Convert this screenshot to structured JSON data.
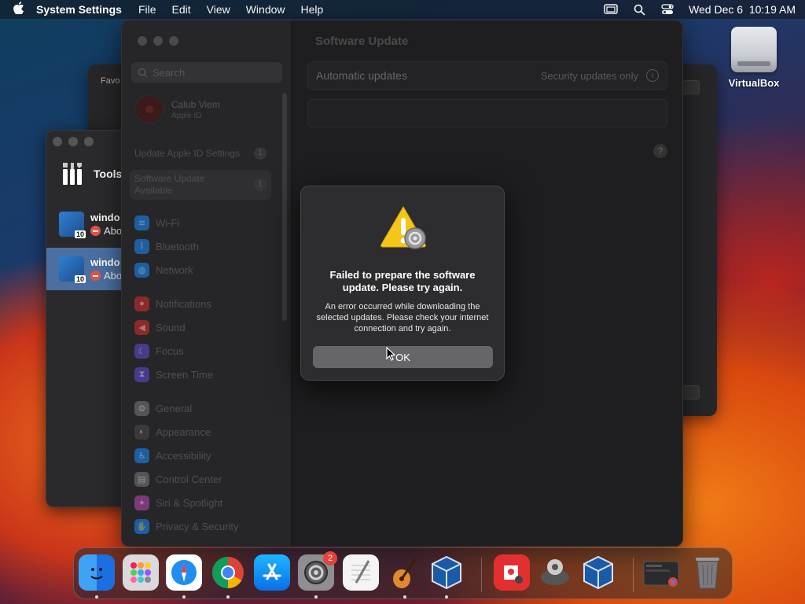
{
  "menubar": {
    "app_name": "System Settings",
    "menus": [
      "File",
      "Edit",
      "View",
      "Window",
      "Help"
    ],
    "datetime": "Wed Dec 6  10:19 AM"
  },
  "desktop": {
    "icons": [
      {
        "label": "VirtualBox",
        "icon": "disk-icon"
      }
    ]
  },
  "background_window": {
    "sidebar_label": "Favo"
  },
  "virtualbox": {
    "tools_label": "Tools",
    "vms": [
      {
        "name": "windo",
        "state": "Abo",
        "selected": false
      },
      {
        "name": "windo",
        "state": "Abo",
        "selected": true
      }
    ]
  },
  "settings": {
    "search_placeholder": "Search",
    "account": {
      "name": "Calub Viem",
      "subtitle": "Apple ID"
    },
    "notices": [
      {
        "label": "Update Apple ID Settings",
        "count": "1"
      },
      {
        "label": "Software Update Available",
        "count": "1"
      }
    ],
    "sidebar_items": [
      {
        "label": "Wi-Fi",
        "icon": "wifi-icon",
        "color": "#1f5f9f"
      },
      {
        "label": "Bluetooth",
        "icon": "bluetooth-icon",
        "color": "#1f5f9f"
      },
      {
        "label": "Network",
        "icon": "network-icon",
        "color": "#1f5f9f"
      },
      {
        "label": "Notifications",
        "icon": "bell-icon",
        "color": "#8a2a2a"
      },
      {
        "label": "Sound",
        "icon": "speaker-icon",
        "color": "#8a2a2a"
      },
      {
        "label": "Focus",
        "icon": "moon-icon",
        "color": "#4a3a8a"
      },
      {
        "label": "Screen Time",
        "icon": "hourglass-icon",
        "color": "#4a3a8a"
      },
      {
        "label": "General",
        "icon": "gear-icon",
        "color": "#555558"
      },
      {
        "label": "Appearance",
        "icon": "appearance-icon",
        "color": "#3a3a3a"
      },
      {
        "label": "Accessibility",
        "icon": "accessibility-icon",
        "color": "#1f5f9f"
      },
      {
        "label": "Control Center",
        "icon": "control-center-icon",
        "color": "#555558"
      },
      {
        "label": "Siri & Spotlight",
        "icon": "siri-icon",
        "color": "#7a3a7a"
      },
      {
        "label": "Privacy & Security",
        "icon": "hand-icon",
        "color": "#1f5f9f"
      }
    ],
    "main_title": "Software Update",
    "automatic_updates": {
      "label": "Automatic updates",
      "value": "Security updates only"
    },
    "help_label": "?"
  },
  "alert": {
    "title": "Failed to prepare the software update. Please try again.",
    "message": "An error occurred while downloading the selected updates. Please check your internet connection and try again.",
    "ok_label": "OK",
    "colors": {
      "warning": "#f5c518",
      "button": "#66666a"
    }
  },
  "dock": {
    "items": [
      {
        "name": "finder",
        "icon": "finder-icon",
        "running": true
      },
      {
        "name": "launchpad",
        "icon": "launchpad-icon",
        "running": false
      },
      {
        "name": "safari",
        "icon": "safari-icon",
        "running": true
      },
      {
        "name": "chrome",
        "icon": "chrome-icon",
        "running": true
      },
      {
        "name": "app-store",
        "icon": "app-store-icon",
        "running": false
      },
      {
        "name": "system-settings",
        "icon": "gear-icon",
        "running": true,
        "badge": "2"
      },
      {
        "name": "textedit",
        "icon": "notepad-icon",
        "running": false
      },
      {
        "name": "garageband",
        "icon": "guitar-icon",
        "running": true
      },
      {
        "name": "virtualbox",
        "icon": "virtualbox-icon",
        "running": true
      },
      {
        "name": "photo-booth",
        "icon": "photo-booth-icon",
        "running": false
      },
      {
        "name": "game",
        "icon": "game-icon",
        "running": false
      },
      {
        "name": "virtualbox-2",
        "icon": "virtualbox-icon",
        "running": false
      },
      {
        "name": "chrome-window",
        "icon": "window-thumbnail-icon",
        "running": false
      },
      {
        "name": "trash",
        "icon": "trash-icon",
        "running": false
      }
    ]
  }
}
